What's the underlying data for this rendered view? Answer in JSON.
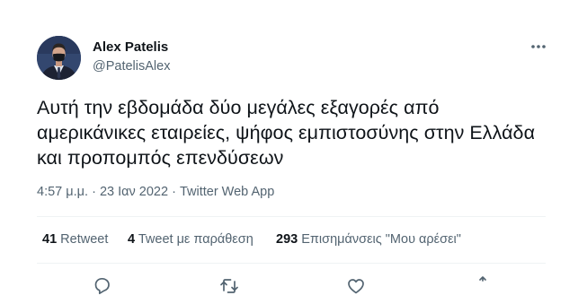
{
  "author": {
    "name": "Alex Patelis",
    "handle": "@PatelisAlex"
  },
  "tweet": {
    "text": "Αυτή την εβδομάδα δύο μεγάλες εξαγορές από αμερικάνικες εταιρείες, ψήφος εμπιστοσύνης στην Ελλάδα και προπομπός επενδύσεων",
    "time": "4:57 μ.μ.",
    "separator": "·",
    "date": "23 Ιαν 2022",
    "source": "Twitter Web App"
  },
  "stats": {
    "retweets_count": "41",
    "retweets_label": "Retweet",
    "quotes_count": "4",
    "quotes_label": "Tweet με παράθεση",
    "likes_count": "293",
    "likes_label": "Επισημάνσεις \"Μου αρέσει\""
  },
  "icons": {
    "more": "more-options-icon",
    "reply": "reply-icon",
    "retweet": "retweet-icon",
    "like": "like-icon",
    "share": "share-icon"
  },
  "colors": {
    "text": "#0f1419",
    "secondary": "#536471",
    "divider": "#eff3f4"
  }
}
